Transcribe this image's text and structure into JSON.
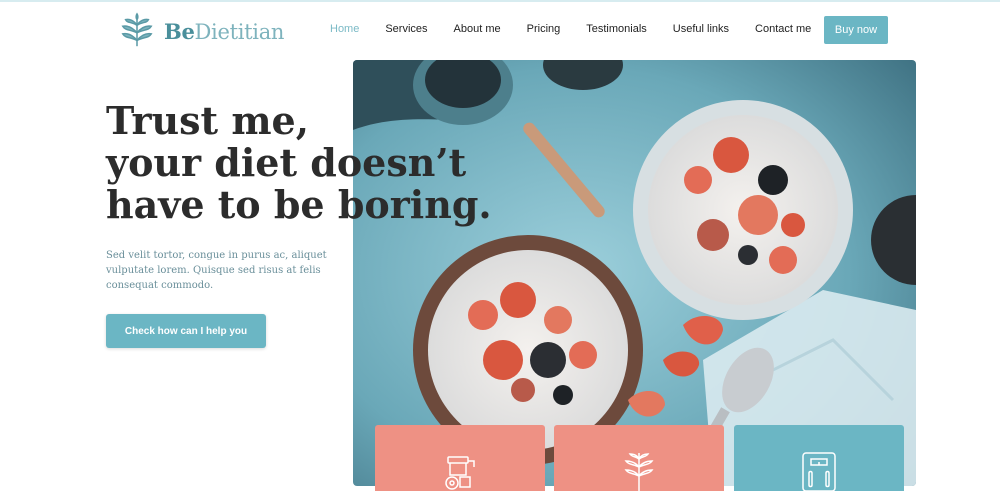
{
  "brand": {
    "name_prefix": "Be",
    "name_rest": "Dietitian",
    "logo_icon": "leaf-plant-icon"
  },
  "nav": {
    "items": [
      {
        "label": "Home",
        "active": true
      },
      {
        "label": "Services"
      },
      {
        "label": "About me"
      },
      {
        "label": "Pricing"
      },
      {
        "label": "Testimonials"
      },
      {
        "label": "Useful links"
      },
      {
        "label": "Contact me"
      }
    ],
    "buy_label": "Buy now"
  },
  "hero": {
    "headline_lines": [
      "Trust me,",
      "your diet doesn’t",
      "have to be boring."
    ],
    "subtext": "Sed velit tortor, congue in purus ac, aliquet vulputate lorem. Quisque sed risus at felis consequat commodo.",
    "cta_label": "Check how can I help you"
  },
  "cards": [
    {
      "icon": "mortar-grinder-icon",
      "color": "#ee9184"
    },
    {
      "icon": "plant-sprig-icon",
      "color": "#ee9184"
    },
    {
      "icon": "bathroom-scale-icon",
      "color": "#6bb6c4"
    }
  ],
  "colors": {
    "accent": "#6bb6c4",
    "coral": "#ee9184",
    "text": "#2c2c2c"
  }
}
